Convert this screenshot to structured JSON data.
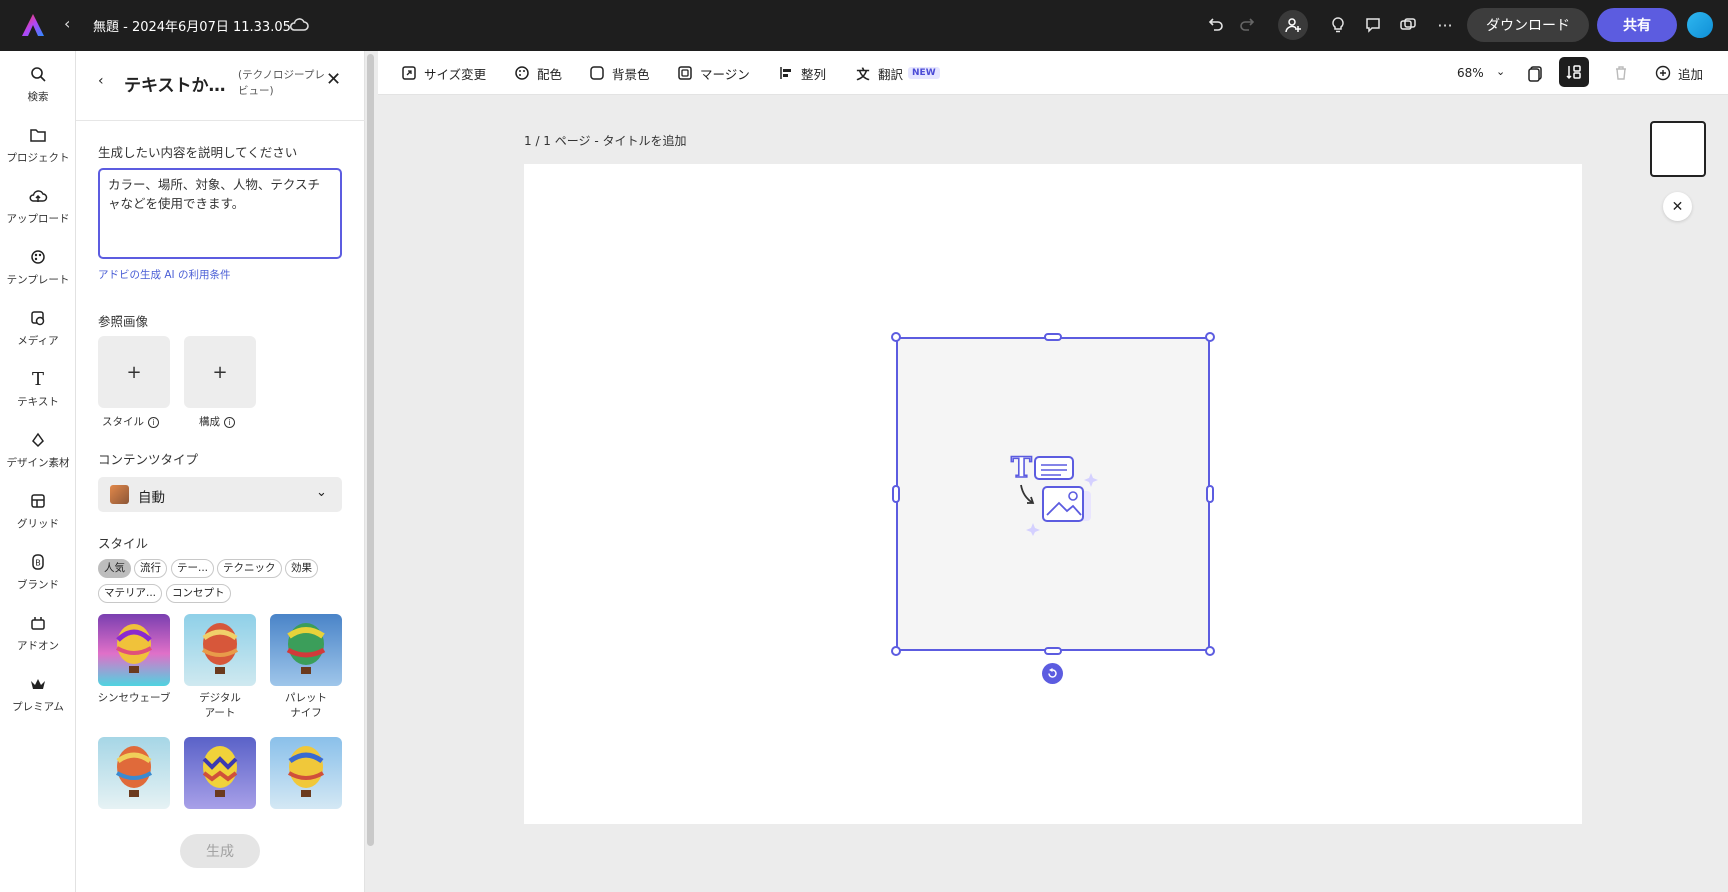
{
  "topbar": {
    "doc_title": "無題 - 2024年6月07日 11.33.05",
    "download_label": "ダウンロード",
    "share_label": "共有"
  },
  "left_rail": {
    "items": [
      {
        "label": "検索",
        "icon": "search-icon"
      },
      {
        "label": "プロジェクト",
        "icon": "folder-icon"
      },
      {
        "label": "アップロード",
        "icon": "upload-cloud-icon"
      },
      {
        "label": "テンプレート",
        "icon": "template-icon"
      },
      {
        "label": "メディア",
        "icon": "media-icon"
      },
      {
        "label": "テキスト",
        "icon": "text-icon"
      },
      {
        "label": "デザイン素材",
        "icon": "shapes-icon"
      },
      {
        "label": "グリッド",
        "icon": "grid-icon"
      },
      {
        "label": "ブランド",
        "icon": "brand-icon"
      },
      {
        "label": "アドオン",
        "icon": "addon-icon"
      },
      {
        "label": "プレミアム",
        "icon": "premium-crown-icon"
      }
    ]
  },
  "panel": {
    "title": "テキストか…",
    "subtitle": "(テクノロジープレビュー)",
    "prompt_label": "生成したい内容を説明してください",
    "prompt_placeholder": "カラー、場所、対象、人物、テクスチャなどを使用できます。",
    "terms_link": "アドビの生成 AI の利用条件",
    "reference_label": "参照画像",
    "reference_style": "スタイル",
    "reference_composition": "構成",
    "content_type_label": "コンテンツタイプ",
    "content_type_value": "自動",
    "style_label": "スタイル",
    "chips": [
      "人気",
      "流行",
      "テー...",
      "テクニック",
      "効果",
      "マテリア...",
      "コンセプト"
    ],
    "style_tiles": [
      {
        "label": "シンセウェーブ"
      },
      {
        "label": "デジタル\nアート"
      },
      {
        "label": "パレット\nナイフ"
      },
      {
        "label": ""
      },
      {
        "label": ""
      },
      {
        "label": ""
      }
    ],
    "generate_label": "生成"
  },
  "toolbar": {
    "resize": "サイズ変更",
    "color": "配色",
    "background": "背景色",
    "margin": "マージン",
    "align": "整列",
    "translate": "翻訳",
    "new_badge": "NEW",
    "zoom": "68%",
    "add": "追加"
  },
  "canvas": {
    "page_label": "1 / 1 ページ - タイトルを追加"
  },
  "colors": {
    "accent": "#5c5ce0",
    "topbar_bg": "#1e1e1e"
  }
}
